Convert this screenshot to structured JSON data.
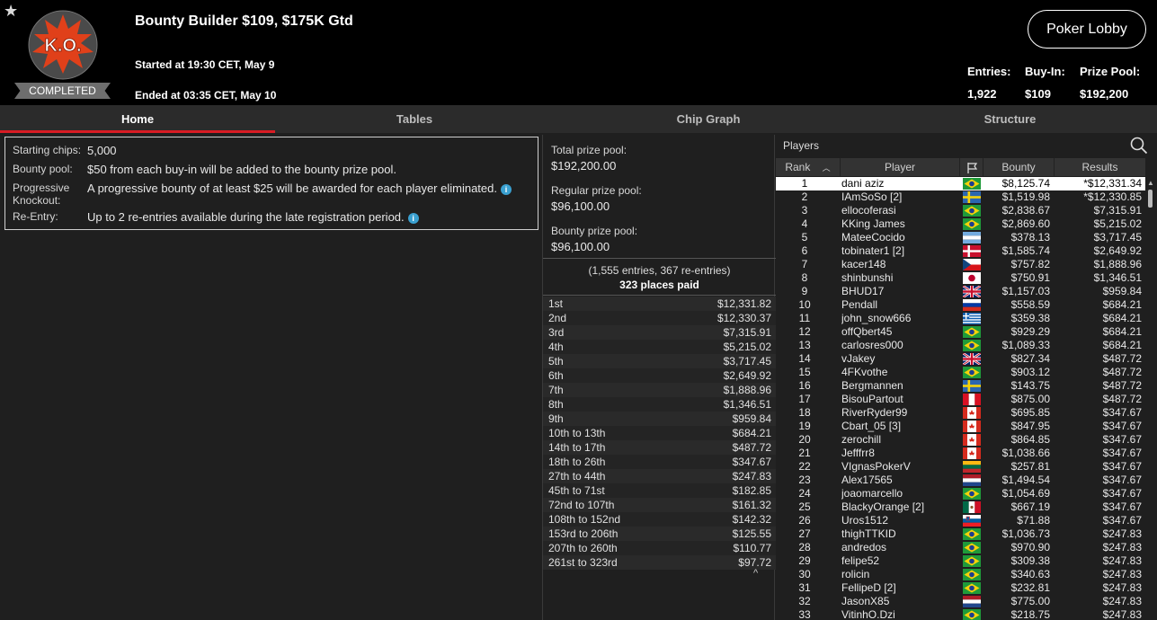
{
  "header": {
    "logo_text": "K.O.",
    "status": "COMPLETED",
    "title": "Bounty Builder $109, $175K Gtd",
    "started": "Started at 19:30 CET, May 9",
    "ended": "Ended at 03:35 CET, May 10",
    "lobby_button": "Poker Lobby",
    "stats": [
      {
        "label": "Entries:",
        "value": "1,922"
      },
      {
        "label": "Buy-In:",
        "value": "$109"
      },
      {
        "label": "Prize Pool:",
        "value": "$192,200"
      }
    ]
  },
  "tabs": [
    {
      "label": "Home",
      "active": true
    },
    {
      "label": "Tables",
      "active": false
    },
    {
      "label": "Chip Graph",
      "active": false
    },
    {
      "label": "Structure",
      "active": false
    }
  ],
  "info": [
    {
      "label": "Starting chips:",
      "value": "5,000",
      "info_icon": false
    },
    {
      "label": "Bounty pool:",
      "value": "$50 from each buy-in will be added to the bounty prize pool.",
      "info_icon": false
    },
    {
      "label": "Progressive Knockout:",
      "value": "A progressive bounty of at least $25 will be awarded for each player eliminated.",
      "info_icon": true
    },
    {
      "label": "Re-Entry:",
      "value": "Up to 2 re-entries available during the late registration period.",
      "info_icon": true
    }
  ],
  "prize": {
    "total_label": "Total prize pool:",
    "total_value": "$192,200.00",
    "regular_label": "Regular prize pool:",
    "regular_value": "$96,100.00",
    "bounty_label": "Bounty prize pool:",
    "bounty_value": "$96,100.00",
    "entries_line": "(1,555 entries, 367 re-entries)",
    "places_line": "323 places paid",
    "payouts": [
      {
        "place": "1st",
        "amount": "$12,331.82"
      },
      {
        "place": "2nd",
        "amount": "$12,330.37"
      },
      {
        "place": "3rd",
        "amount": "$7,315.91"
      },
      {
        "place": "4th",
        "amount": "$5,215.02"
      },
      {
        "place": "5th",
        "amount": "$3,717.45"
      },
      {
        "place": "6th",
        "amount": "$2,649.92"
      },
      {
        "place": "7th",
        "amount": "$1,888.96"
      },
      {
        "place": "8th",
        "amount": "$1,346.51"
      },
      {
        "place": "9th",
        "amount": "$959.84"
      },
      {
        "place": "10th to 13th",
        "amount": "$684.21"
      },
      {
        "place": "14th to 17th",
        "amount": "$487.72"
      },
      {
        "place": "18th to 26th",
        "amount": "$347.67"
      },
      {
        "place": "27th to 44th",
        "amount": "$247.83"
      },
      {
        "place": "45th to 71st",
        "amount": "$182.85"
      },
      {
        "place": "72nd to 107th",
        "amount": "$161.32"
      },
      {
        "place": "108th to 152nd",
        "amount": "$142.32"
      },
      {
        "place": "153rd to 206th",
        "amount": "$125.55"
      },
      {
        "place": "207th to 260th",
        "amount": "$110.77"
      },
      {
        "place": "261st to 323rd",
        "amount": "$97.72"
      }
    ]
  },
  "players": {
    "title": "Players",
    "columns": [
      "Rank",
      "Player",
      "Bounty",
      "Results"
    ],
    "rows": [
      {
        "rank": "1",
        "name": "dani aziz",
        "flag": "BR",
        "bounty": "$8,125.74",
        "result": "*$12,331.34",
        "selected": true
      },
      {
        "rank": "2",
        "name": "IAmSoSo [2]",
        "flag": "SE",
        "bounty": "$1,519.98",
        "result": "*$12,330.85"
      },
      {
        "rank": "3",
        "name": "ellocoferasi",
        "flag": "BR",
        "bounty": "$2,838.67",
        "result": "$7,315.91"
      },
      {
        "rank": "4",
        "name": "KKing James",
        "flag": "BR",
        "bounty": "$2,869.60",
        "result": "$5,215.02"
      },
      {
        "rank": "5",
        "name": "MateeCocido",
        "flag": "AR",
        "bounty": "$378.13",
        "result": "$3,717.45"
      },
      {
        "rank": "6",
        "name": "tobinater1 [2]",
        "flag": "DK",
        "bounty": "$1,585.74",
        "result": "$2,649.92"
      },
      {
        "rank": "7",
        "name": "kacer148",
        "flag": "CZ",
        "bounty": "$757.82",
        "result": "$1,888.96"
      },
      {
        "rank": "8",
        "name": "shinbunshi",
        "flag": "JP",
        "bounty": "$750.91",
        "result": "$1,346.51"
      },
      {
        "rank": "9",
        "name": "BHUD17",
        "flag": "GB",
        "bounty": "$1,157.03",
        "result": "$959.84"
      },
      {
        "rank": "10",
        "name": "Pendall",
        "flag": "RU",
        "bounty": "$558.59",
        "result": "$684.21"
      },
      {
        "rank": "11",
        "name": "john_snow666",
        "flag": "GR",
        "bounty": "$359.38",
        "result": "$684.21"
      },
      {
        "rank": "12",
        "name": "offQbert45",
        "flag": "BR",
        "bounty": "$929.29",
        "result": "$684.21"
      },
      {
        "rank": "13",
        "name": "carlosres000",
        "flag": "BR",
        "bounty": "$1,089.33",
        "result": "$684.21"
      },
      {
        "rank": "14",
        "name": "vJakey",
        "flag": "GB",
        "bounty": "$827.34",
        "result": "$487.72"
      },
      {
        "rank": "15",
        "name": "4FKvothe",
        "flag": "BR",
        "bounty": "$903.12",
        "result": "$487.72"
      },
      {
        "rank": "16",
        "name": "Bergmannen",
        "flag": "SE",
        "bounty": "$143.75",
        "result": "$487.72"
      },
      {
        "rank": "17",
        "name": "BisouPartout",
        "flag": "PE",
        "bounty": "$875.00",
        "result": "$487.72"
      },
      {
        "rank": "18",
        "name": "RiverRyder99",
        "flag": "CA",
        "bounty": "$695.85",
        "result": "$347.67"
      },
      {
        "rank": "19",
        "name": "Cbart_05 [3]",
        "flag": "CA",
        "bounty": "$847.95",
        "result": "$347.67"
      },
      {
        "rank": "20",
        "name": "zerochill",
        "flag": "CA",
        "bounty": "$864.85",
        "result": "$347.67"
      },
      {
        "rank": "21",
        "name": "Jefffrr8",
        "flag": "CA",
        "bounty": "$1,038.66",
        "result": "$347.67"
      },
      {
        "rank": "22",
        "name": "VIgnasPokerV",
        "flag": "LT",
        "bounty": "$257.81",
        "result": "$347.67"
      },
      {
        "rank": "23",
        "name": "Alex17565",
        "flag": "NL",
        "bounty": "$1,494.54",
        "result": "$347.67"
      },
      {
        "rank": "24",
        "name": "joaomarcello",
        "flag": "BR",
        "bounty": "$1,054.69",
        "result": "$347.67"
      },
      {
        "rank": "25",
        "name": "BlackyOrange [2]",
        "flag": "MX",
        "bounty": "$667.19",
        "result": "$347.67"
      },
      {
        "rank": "26",
        "name": "Uros1512",
        "flag": "SI",
        "bounty": "$71.88",
        "result": "$347.67"
      },
      {
        "rank": "27",
        "name": "thighTTKID",
        "flag": "BR",
        "bounty": "$1,036.73",
        "result": "$247.83"
      },
      {
        "rank": "28",
        "name": "andredos",
        "flag": "BR",
        "bounty": "$970.90",
        "result": "$247.83"
      },
      {
        "rank": "29",
        "name": "felipe52",
        "flag": "BR",
        "bounty": "$309.38",
        "result": "$247.83"
      },
      {
        "rank": "30",
        "name": "rolicin",
        "flag": "BR",
        "bounty": "$340.63",
        "result": "$247.83"
      },
      {
        "rank": "31",
        "name": "FellipeD [2]",
        "flag": "BR",
        "bounty": "$232.81",
        "result": "$247.83"
      },
      {
        "rank": "32",
        "name": "JasonX85",
        "flag": "NL",
        "bounty": "$775.00",
        "result": "$247.83"
      },
      {
        "rank": "33",
        "name": "VitinhO.Dzi",
        "flag": "BR",
        "bounty": "$218.75",
        "result": "$247.83"
      }
    ]
  },
  "colors": {
    "accent": "#d91c24",
    "header_bg": "#000000",
    "panel_bg": "#1f1f1f"
  },
  "icons": [
    "star-icon",
    "ko-logo",
    "search-icon",
    "flag-icon",
    "sort-up-icon",
    "info-icon",
    "chevron-up-icon"
  ]
}
